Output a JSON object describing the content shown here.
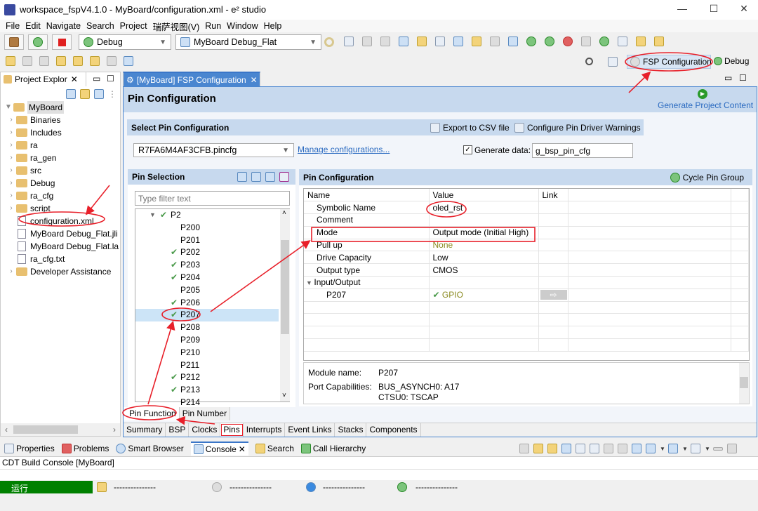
{
  "window": {
    "title": "workspace_fspV4.1.0 - MyBoard/configuration.xml - e² studio",
    "controls": [
      "minimize",
      "maximize",
      "close"
    ]
  },
  "menu": [
    "File",
    "Edit",
    "Navigate",
    "Search",
    "Project",
    "瑞萨视图(V)",
    "Run",
    "Window",
    "Help"
  ],
  "toolbar": {
    "launch_mode": "Debug",
    "launch_config": "MyBoard Debug_Flat"
  },
  "perspectives": {
    "fsp": "FSP Configuration",
    "debug": "Debug"
  },
  "project_explorer": {
    "tab": "Project Explor",
    "root": "MyBoard",
    "items": [
      {
        "label": "Binaries",
        "folder": true
      },
      {
        "label": "Includes",
        "folder": true
      },
      {
        "label": "ra",
        "folder": true
      },
      {
        "label": "ra_gen",
        "folder": true
      },
      {
        "label": "src",
        "folder": true
      },
      {
        "label": "Debug",
        "folder": true
      },
      {
        "label": "ra_cfg",
        "folder": true
      },
      {
        "label": "script",
        "folder": true
      },
      {
        "label": "configuration.xml",
        "folder": false
      },
      {
        "label": "MyBoard Debug_Flat.jli",
        "folder": false
      },
      {
        "label": "MyBoard Debug_Flat.la",
        "folder": false
      },
      {
        "label": "ra_cfg.txt",
        "folder": false
      },
      {
        "label": "Developer Assistance",
        "folder": true
      }
    ]
  },
  "editor": {
    "tab": "[MyBoard] FSP Configuration",
    "title": "Pin Configuration",
    "generate": "Generate Project Content",
    "select_section": "Select Pin Configuration",
    "export_csv": "Export to CSV file",
    "configure_warnings": "Configure Pin Driver Warnings",
    "pincfg_file": "R7FA6M4AF3CFB.pincfg",
    "manage": "Manage configurations...",
    "generate_data_label": "Generate data:",
    "generate_data_checked": true,
    "generate_data_value": "g_bsp_pin_cfg",
    "pin_selection": {
      "title": "Pin Selection",
      "filter_placeholder": "Type filter text",
      "group": "P2",
      "pins": [
        {
          "name": "P200",
          "ok": false
        },
        {
          "name": "P201",
          "ok": false
        },
        {
          "name": "P202",
          "ok": true
        },
        {
          "name": "P203",
          "ok": true
        },
        {
          "name": "P204",
          "ok": true
        },
        {
          "name": "P205",
          "ok": false
        },
        {
          "name": "P206",
          "ok": true
        },
        {
          "name": "P207",
          "ok": true,
          "selected": true
        },
        {
          "name": "P208",
          "ok": false
        },
        {
          "name": "P209",
          "ok": false
        },
        {
          "name": "P210",
          "ok": false
        },
        {
          "name": "P211",
          "ok": false
        },
        {
          "name": "P212",
          "ok": true
        },
        {
          "name": "P213",
          "ok": true
        },
        {
          "name": "P214",
          "ok": false
        }
      ],
      "tabs": [
        "Pin Function",
        "Pin Number"
      ]
    },
    "pin_config": {
      "title": "Pin Configuration",
      "cycle": "Cycle Pin Group",
      "headers": [
        "Name",
        "Value",
        "Link"
      ],
      "rows": [
        {
          "name": "Symbolic Name",
          "value": "oled_rst"
        },
        {
          "name": "Comment",
          "value": ""
        },
        {
          "name": "Mode",
          "value": "Output mode (Initial High)"
        },
        {
          "name": "Pull up",
          "value": "None"
        },
        {
          "name": "Drive Capacity",
          "value": "Low"
        },
        {
          "name": "Output type",
          "value": "CMOS"
        },
        {
          "name": "Input/Output",
          "value": ""
        },
        {
          "name": "P207",
          "value": "GPIO"
        }
      ],
      "module_label": "Module name:",
      "module_value": "P207",
      "caps_label": "Port Capabilities:",
      "caps": [
        "BUS_ASYNCH0: A17",
        "CTSU0: TSCAP"
      ]
    },
    "bottom_tabs": [
      "Summary",
      "BSP",
      "Clocks",
      "Pins",
      "Interrupts",
      "Event Links",
      "Stacks",
      "Components"
    ],
    "active_bottom_tab": "Pins"
  },
  "console": {
    "tabs": [
      "Properties",
      "Problems",
      "Smart Browser",
      "Console",
      "Search",
      "Call Hierarchy"
    ],
    "active": "Console",
    "title": "CDT Build Console [MyBoard]"
  },
  "status": {
    "run": "运行",
    "fields": [
      "---------------",
      "---------------",
      "---------------",
      "---------------"
    ]
  },
  "colors": {
    "accent": "#c7d9ee",
    "annotation": "#e8202a",
    "status_green": "#008000",
    "link": "#2a6ac0"
  }
}
